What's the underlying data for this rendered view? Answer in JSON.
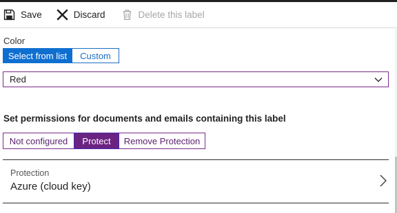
{
  "toolbar": {
    "save_label": "Save",
    "discard_label": "Discard",
    "delete_label": "Delete this label"
  },
  "color": {
    "label": "Color",
    "options": [
      "Select from list",
      "Custom"
    ],
    "selected_option": "Select from list",
    "dropdown_value": "Red"
  },
  "permissions": {
    "heading": "Set permissions for documents and emails containing this label",
    "options": [
      "Not configured",
      "Protect",
      "Remove Protection"
    ],
    "selected_option": "Protect"
  },
  "protection": {
    "title": "Protection",
    "value": "Azure (cloud key)"
  },
  "colors": {
    "accent_blue": "#0f6fd1",
    "accent_purple": "#6b2381",
    "border_purple": "#7b2a8c",
    "disabled_text": "#a6a6a6"
  },
  "icons": {
    "save": "save-icon",
    "discard": "close-icon",
    "delete": "trash-icon",
    "dropdown": "chevron-down-icon",
    "navigate": "chevron-right-icon"
  }
}
